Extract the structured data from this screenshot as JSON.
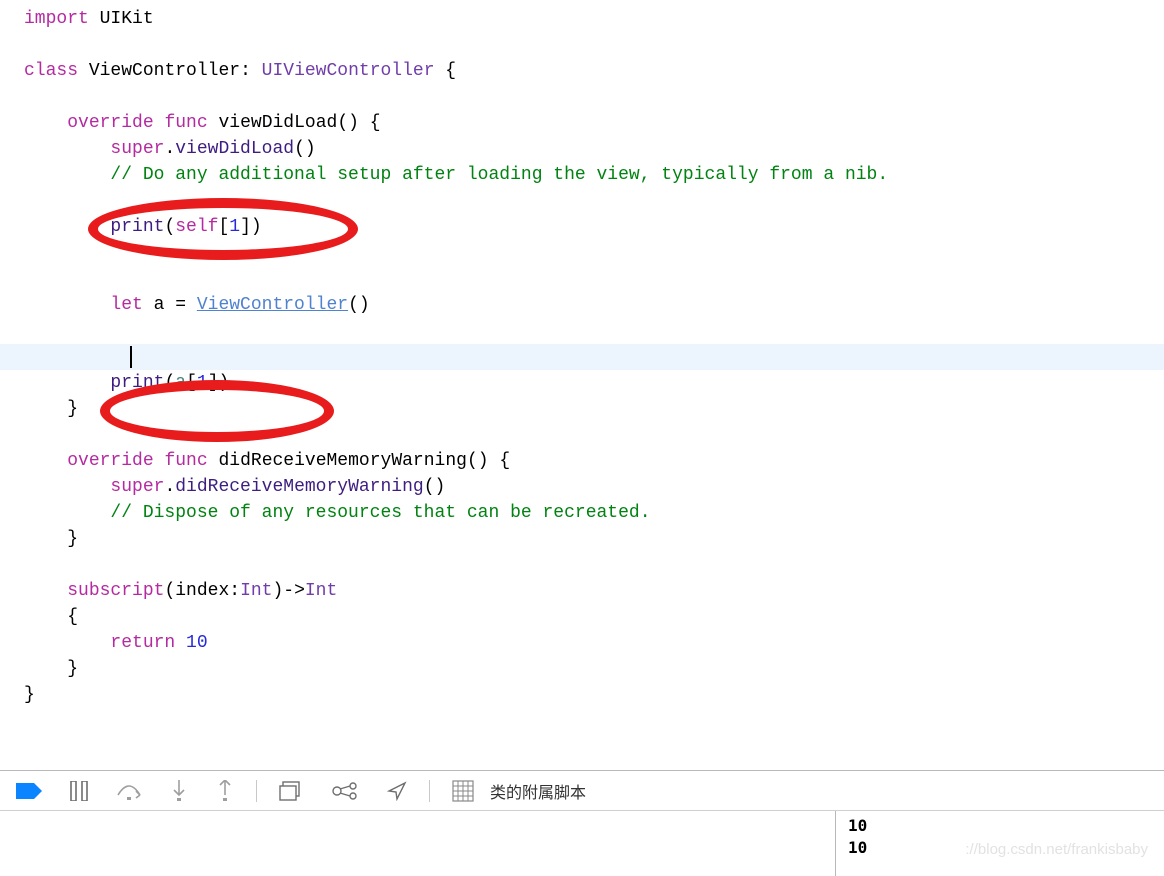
{
  "code": {
    "line1": {
      "import": "import",
      "uikit": "UIKit"
    },
    "line3": {
      "class": "class",
      "name": "ViewController",
      "super": "UIViewController",
      "open": " {"
    },
    "line5": {
      "override": "override",
      "func": "func",
      "name": "viewDidLoad",
      "sig": "() {"
    },
    "line6": {
      "super": "super",
      "dot": ".",
      "call": "viewDidLoad",
      "tail": "()"
    },
    "line7": {
      "comment": "// Do any additional setup after loading the view, typically from a nib."
    },
    "line9": {
      "print": "print",
      "open": "(",
      "self": "self",
      "sub": "[",
      "num": "1",
      "close": "])"
    },
    "line12": {
      "let": "let",
      "a": " a = ",
      "ctor": "ViewController",
      "tail": "()"
    },
    "line14": {
      "print": "print",
      "open": "(",
      "a": "a",
      "sub": "[",
      "num": "1",
      "close": "])"
    },
    "line15": {
      "brace": "}"
    },
    "line17": {
      "override": "override",
      "func": "func",
      "name": "didReceiveMemoryWarning",
      "sig": "() {"
    },
    "line18": {
      "super": "super",
      "dot": ".",
      "call": "didReceiveMemoryWarning",
      "tail": "()"
    },
    "line19": {
      "comment": "// Dispose of any resources that can be recreated."
    },
    "line20": {
      "brace": "}"
    },
    "line22": {
      "subscript": "subscript",
      "sig1": "(index:",
      "int1": "Int",
      "arrow": ")->",
      "int2": "Int"
    },
    "line23": {
      "brace": "{"
    },
    "line24": {
      "return": "return",
      "num": "10"
    },
    "line25": {
      "brace": "}"
    },
    "line26": {
      "brace": "}"
    }
  },
  "toolbar": {
    "label": "类的附属脚本"
  },
  "console": {
    "out1": "10",
    "out2": "10"
  },
  "watermark": "://blog.csdn.net/frankisbaby"
}
